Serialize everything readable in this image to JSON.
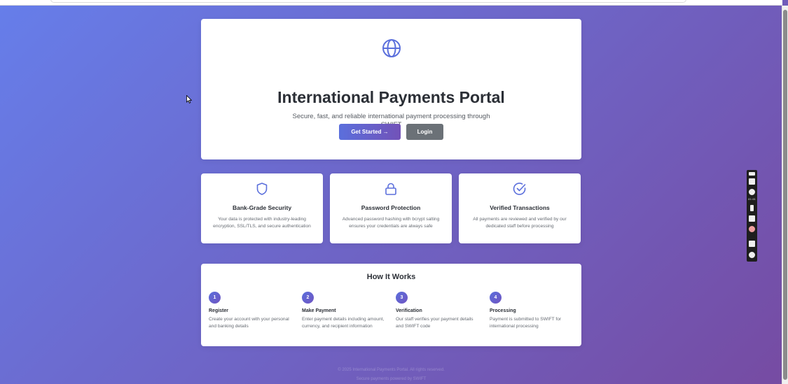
{
  "hero": {
    "title": "International Payments Portal",
    "subtitle": "Secure, fast, and reliable international payment processing through SWIFT",
    "primary_button": "Get Started →",
    "secondary_button": "Login",
    "icon": "globe-icon"
  },
  "features": [
    {
      "icon": "shield-icon",
      "title": "Bank-Grade Security",
      "description": "Your data is protected with industry-leading encryption, SSL/TLS, and secure authentication"
    },
    {
      "icon": "lock-icon",
      "title": "Password Protection",
      "description": "Advanced password hashing with bcrypt salting ensures your credentials are always safe"
    },
    {
      "icon": "check-circle-icon",
      "title": "Verified Transactions",
      "description": "All payments are reviewed and verified by our dedicated staff before processing"
    }
  ],
  "how_it_works": {
    "title": "How It Works",
    "steps": [
      {
        "number": "1",
        "title": "Register",
        "description": "Create your account with your personal and banking details"
      },
      {
        "number": "2",
        "title": "Make Payment",
        "description": "Enter payment details including amount, currency, and recipient information"
      },
      {
        "number": "3",
        "title": "Verification",
        "description": "Our staff verifies your payment details and SWIFT code"
      },
      {
        "number": "4",
        "title": "Processing",
        "description": "Payment is submitted to SWIFT for international processing"
      }
    ]
  },
  "footer": {
    "line1": "© 2025 International Payments Portal. All rights reserved.",
    "line2": "Secure payments powered by SWIFT"
  },
  "recorder": {
    "timer": "01:01"
  },
  "colors": {
    "gradient_start": "#667eea",
    "gradient_end": "#764ba2",
    "accent": "#5b6fdc",
    "login_button": "#6b7177"
  }
}
